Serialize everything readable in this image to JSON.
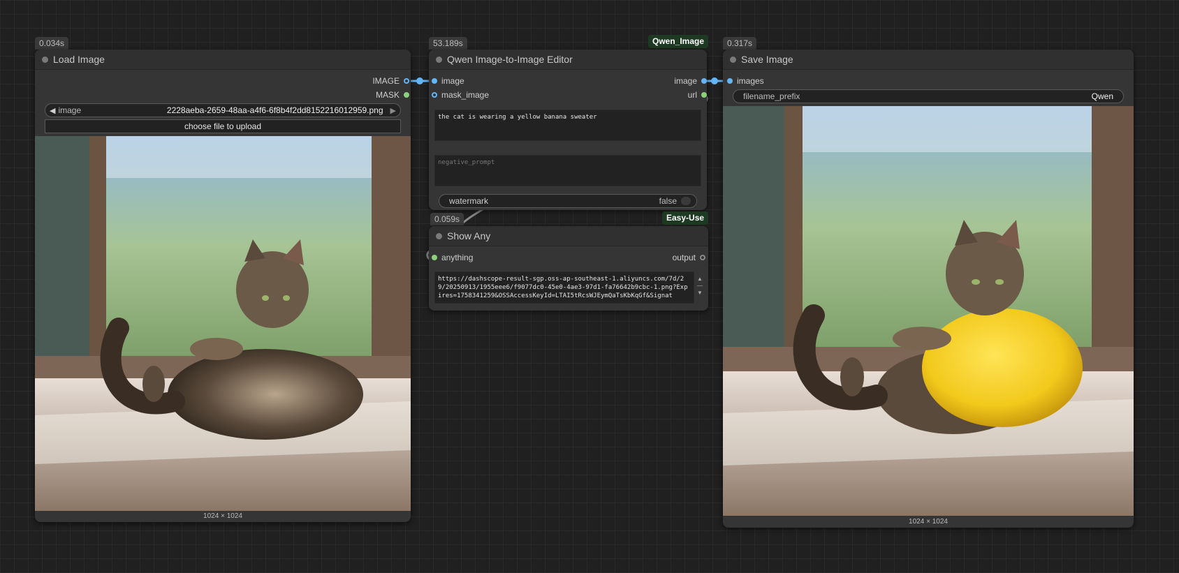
{
  "nodes": {
    "load_image": {
      "time": "0.034s",
      "title": "Load Image",
      "outputs": [
        "IMAGE",
        "MASK"
      ],
      "image_widget_label": "image",
      "image_widget_value": "2228aeba-2659-48aa-a4f6-6f8b4f2dd8152216012959.png",
      "upload_label": "choose file to upload",
      "dims": "1024 × 1024"
    },
    "qwen_editor": {
      "time": "53.189s",
      "group": "Qwen_Image",
      "title": "Qwen Image-to-Image Editor",
      "inputs": [
        "image",
        "mask_image"
      ],
      "outputs": [
        "image",
        "url"
      ],
      "prompt": "the cat is wearing a yellow banana sweater",
      "negative_placeholder": "negative_prompt",
      "watermark_label": "watermark",
      "watermark_value": "false"
    },
    "show_any": {
      "time": "0.059s",
      "group": "Easy-Use",
      "title": "Show Any",
      "input": "anything",
      "output": "output",
      "text": "https://dashscope-result-sgp.oss-ap-southeast-1.aliyuncs.com/7d/29/20250913/1955eee6/f9077dc0-45e0-4ae3-97d1-fa76642b9cbc-1.png?Expires=1758341259&OSSAccessKeyId=LTAI5tRcsWJEymQaTsKbKqGf&Signat"
    },
    "save_image": {
      "time": "0.317s",
      "title": "Save Image",
      "input": "images",
      "prefix_label": "filename_prefix",
      "prefix_value": "Qwen",
      "dims": "1024 × 1024"
    }
  },
  "icons": {
    "arrow_left": "◀",
    "arrow_right": "▶",
    "scroll_up": "▲",
    "scroll_down": "▼"
  },
  "colors": {
    "link_blue": "#64b5f6",
    "pin_green": "#8bd07a",
    "group_tag": "#1f3a23"
  }
}
